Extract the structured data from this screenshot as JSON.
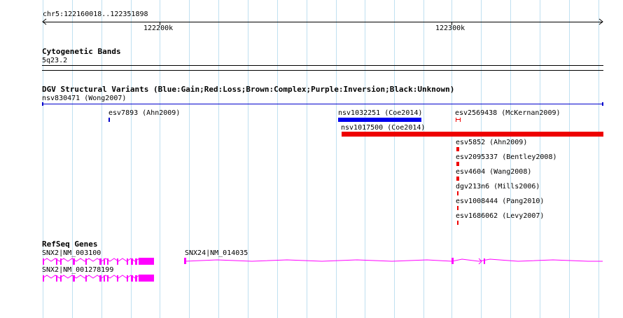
{
  "ruler": {
    "position": "chr5:122160018..122351898",
    "ticks": [
      "122200k",
      "122300k"
    ]
  },
  "cytoband": {
    "title": "Cytogenetic Bands",
    "band": "5q23.2"
  },
  "dgv": {
    "title": "DGV Structural Variants (Blue:Gain;Red:Loss;Brown:Complex;Purple:Inversion;Black:Unknown)",
    "variants": [
      {
        "label": "nsv830471 (Wong2007)",
        "color": "#0000cc"
      },
      {
        "label": "esv7893 (Ahn2009)",
        "color": "#0000cc"
      },
      {
        "label": "nsv1032251 (Coe2014)",
        "color": "#0000ee"
      },
      {
        "label": "esv2569438 (McKernan2009)",
        "color": "#ee0000"
      },
      {
        "label": "nsv1017500 (Coe2014)",
        "color": "#ee0000"
      },
      {
        "label": "esv5852 (Ahn2009)",
        "color": "#ee0000"
      },
      {
        "label": "esv2095337 (Bentley2008)",
        "color": "#ee0000"
      },
      {
        "label": "esv4604 (Wang2008)",
        "color": "#ee0000"
      },
      {
        "label": "dgv213n6 (Mills2006)",
        "color": "#ee0000"
      },
      {
        "label": "esv1008444 (Pang2010)",
        "color": "#ee0000"
      },
      {
        "label": "esv1686062 (Levy2007)",
        "color": "#ee0000"
      }
    ]
  },
  "refseq": {
    "title": "RefSeq Genes",
    "color": "#ff00ff",
    "genes": [
      {
        "label": "SNX2|NM_003100"
      },
      {
        "label": "SNX24|NM_014035"
      },
      {
        "label": "SNX2|NM_001278199"
      }
    ]
  }
}
